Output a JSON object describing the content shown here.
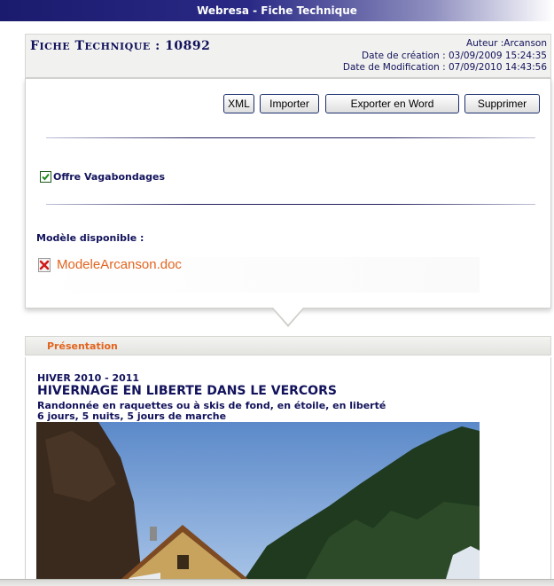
{
  "window": {
    "title": "Webresa - Fiche Technique"
  },
  "fiche": {
    "title_word1_cap": "F",
    "title_word1_rest": "iche",
    "title_word2_cap": "T",
    "title_word2_rest": "echnique",
    "title_sep": " : ",
    "number": "10892",
    "author": "Auteur :Arcanson",
    "created": "Date de création : 03/09/2009 15:24:35",
    "modified": "Date de Modification : 07/09/2010 14:43:56"
  },
  "toolbar": {
    "xml_label": "XML",
    "import_label": "Importer",
    "export_word_label": "Exporter en Word",
    "delete_label": "Supprimer"
  },
  "offer": {
    "label": "Offre Vagabondages",
    "checked": true
  },
  "modele": {
    "label": "Modèle disponible :",
    "file_name": "ModeleArcanson.doc"
  },
  "presentation": {
    "tab_label": "Présentation",
    "season": "HIVER 2010 - 2011",
    "title": "HIVERNAGE EN LIBERTE DANS LE VERCORS",
    "subtitle": "Randonnée en raquettes ou à skis de fond, en étoile, en liberté",
    "duration": "6 jours, 5 nuits, 5 jours de marche"
  },
  "colors": {
    "title_navy": "#12125c",
    "accent_orange": "#e3641e",
    "titlebar_navy": "#1a1a6e"
  },
  "icons": {
    "file_status": "red-cross-icon",
    "checkbox": "checkmark-icon"
  }
}
